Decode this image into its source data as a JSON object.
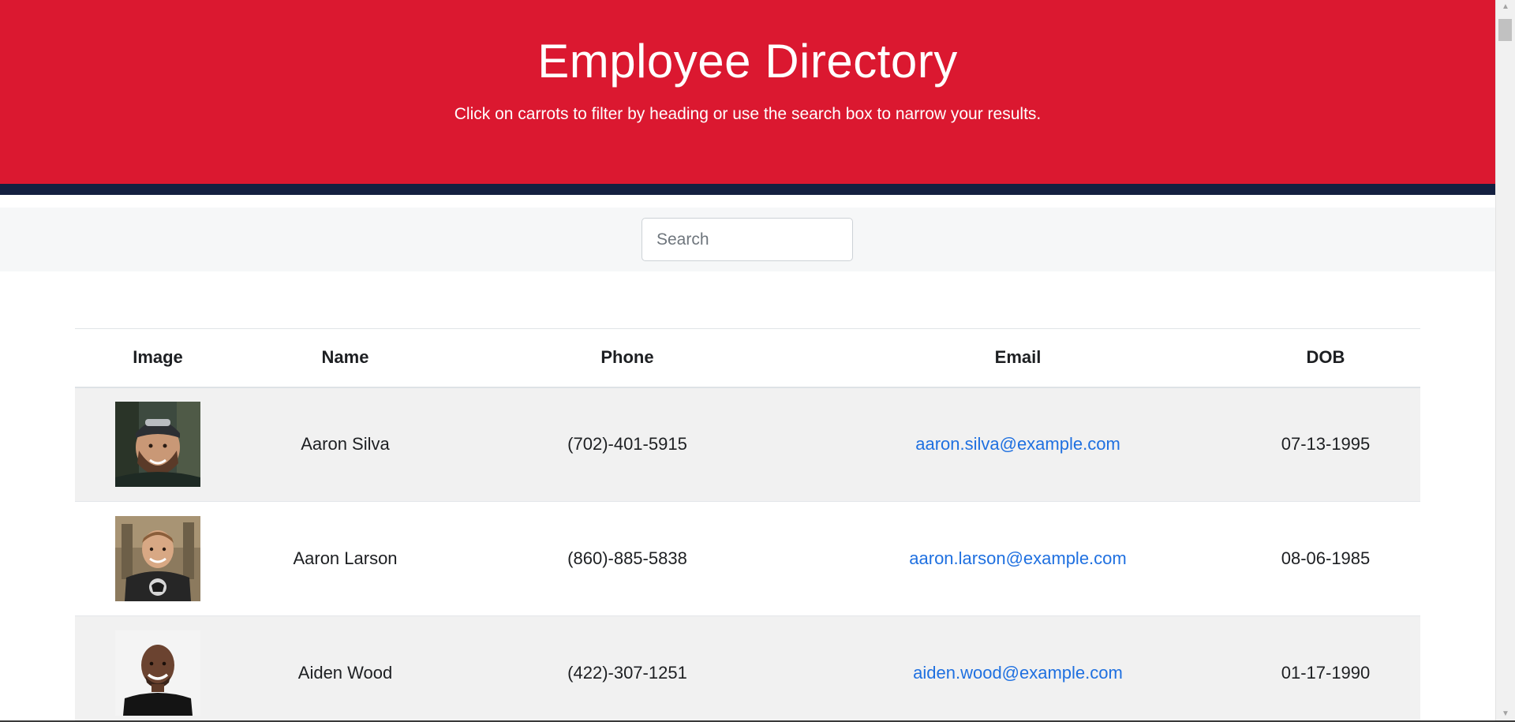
{
  "header": {
    "title": "Employee Directory",
    "subtitle": "Click on carrots to filter by heading or use the search box to narrow your results."
  },
  "search": {
    "placeholder": "Search",
    "value": ""
  },
  "table": {
    "columns": [
      "Image",
      "Name",
      "Phone",
      "Email",
      "DOB"
    ],
    "rows": [
      {
        "image": "employee-photo-aaron-silva",
        "name": "Aaron Silva",
        "phone": "(702)-401-5915",
        "email": "aaron.silva@example.com",
        "dob": "07-13-1995"
      },
      {
        "image": "employee-photo-aaron-larson",
        "name": "Aaron Larson",
        "phone": "(860)-885-5838",
        "email": "aaron.larson@example.com",
        "dob": "08-06-1985"
      },
      {
        "image": "employee-photo-aiden-wood",
        "name": "Aiden Wood",
        "phone": "(422)-307-1251",
        "email": "aiden.wood@example.com",
        "dob": "01-17-1990"
      }
    ]
  },
  "colors": {
    "header_red": "#db1830",
    "header_band_navy": "#142040",
    "link_blue": "#1f70e0",
    "row_stripe": "#f1f1f1"
  }
}
